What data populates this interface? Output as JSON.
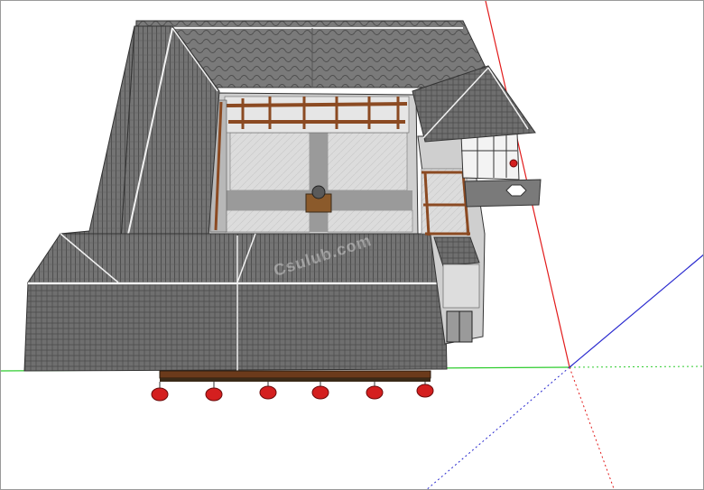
{
  "viewport": {
    "background": "#ffffff",
    "axes": {
      "green": "#2ecc2e",
      "red": "#e21b1b",
      "blue": "#2a2acf"
    }
  },
  "model": {
    "roof_color": "#6f6f6f",
    "roof_dark": "#4a4a4a",
    "ridge_color": "#f0f0f0",
    "courtyard_color": "#d8d8d8",
    "path_color": "#9a9a9a",
    "beam_color": "#8b4a22",
    "lantern_color": "#d41f1f"
  },
  "watermark": {
    "text": "Csulub.com",
    "logo": "watermark-logo"
  }
}
